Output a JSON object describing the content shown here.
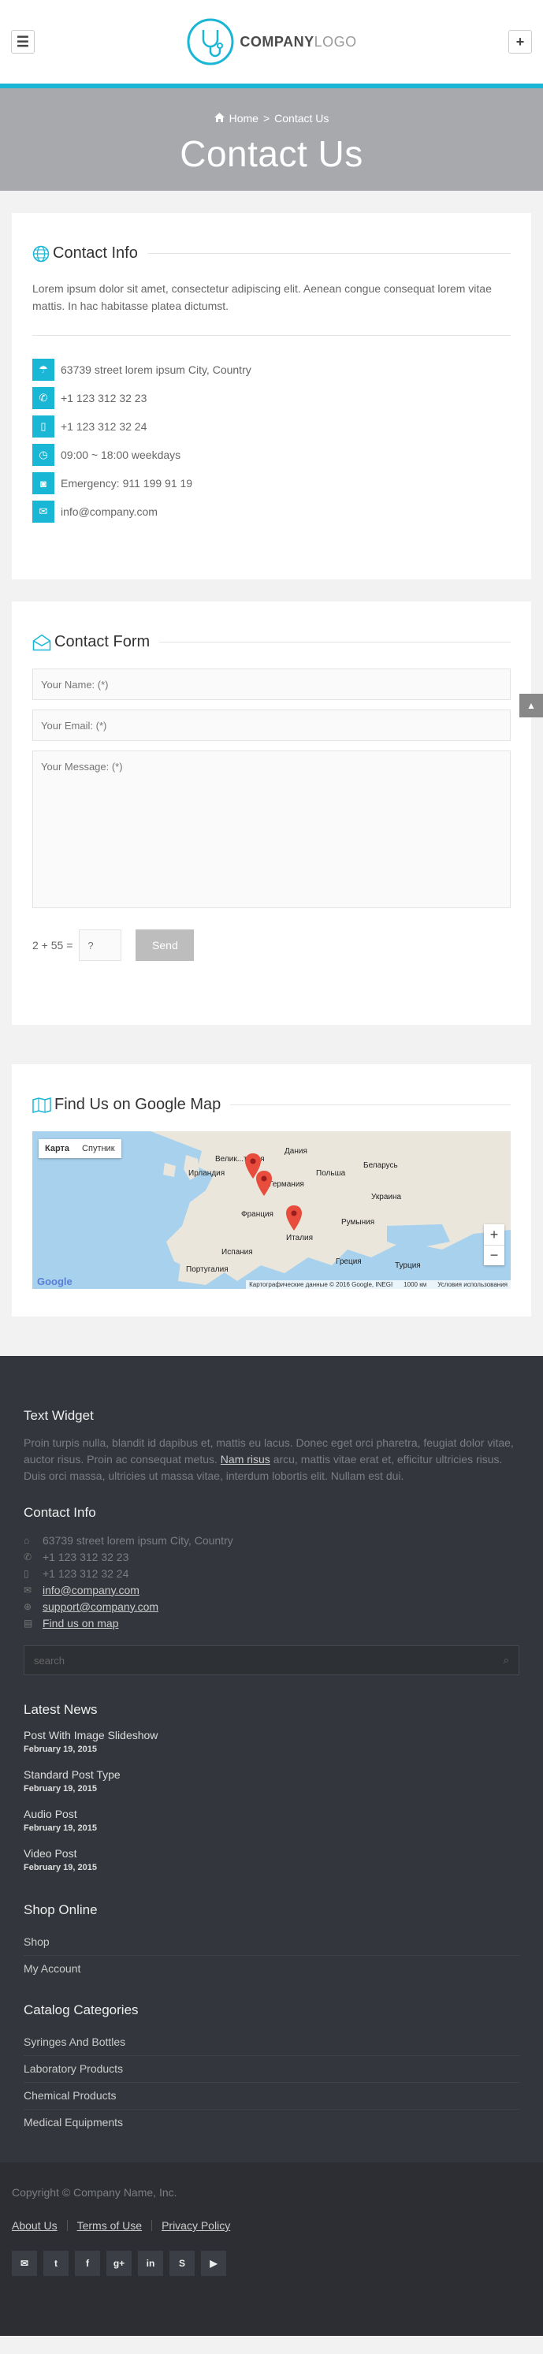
{
  "header": {
    "logo_bold": "COMPANY",
    "logo_light": "LOGO",
    "menu_icon": "hamburger-icon",
    "plus_icon": "plus-icon"
  },
  "banner": {
    "home_label": "Home",
    "separator": ">",
    "current": "Contact Us",
    "title": "Contact Us"
  },
  "contact_info": {
    "title": "Contact Info",
    "description": "Lorem ipsum dolor sit amet, consectetur adipiscing elit. Aenean congue consequat lorem vitae mattis. In hac habitasse platea dictumst.",
    "items": [
      {
        "icon": "map-pin-icon",
        "text": "63739 street lorem ipsum City, Country"
      },
      {
        "icon": "phone-icon",
        "text": "+1 123 312 32 23"
      },
      {
        "icon": "mobile-icon",
        "text": "+1 123 312 32 24"
      },
      {
        "icon": "clock-icon",
        "text": "09:00 ~ 18:00 weekdays"
      },
      {
        "icon": "camera-icon",
        "text": "Emergency: 911 199 91 19"
      },
      {
        "icon": "envelope-icon",
        "text": "info@company.com"
      }
    ]
  },
  "contact_form": {
    "title": "Contact Form",
    "name_placeholder": "Your Name: (*)",
    "email_placeholder": "Your Email: (*)",
    "message_placeholder": "Your Message: (*)",
    "captcha_question": "2 + 55 =",
    "captcha_placeholder": "?",
    "send_label": "Send"
  },
  "map_section": {
    "title": "Find Us on Google Map",
    "tab_map": "Карта",
    "tab_satellite": "Спутник",
    "labels": [
      "Ирландия",
      "Велик...тания",
      "Дания",
      "Германия",
      "Польша",
      "Беларусь",
      "Украина",
      "Франция",
      "Румыния",
      "Италия",
      "Испания",
      "Португалия",
      "Греция",
      "Турция"
    ],
    "attribution": "Картографические данные © 2016 Google, INEGI",
    "scale": "1000 км",
    "terms": "Условия использования",
    "google": "Google"
  },
  "footer": {
    "text_widget_title": "Text Widget",
    "text_before": "Proin turpis nulla, blandit id dapibus et, mattis eu lacus. Donec eget orci pharetra, feugiat dolor vitae, auctor risus. Proin ac consequat metus. ",
    "text_link": "Nam risus",
    "text_after": " arcu, mattis vitae erat et, efficitur ultricies risus. Duis orci massa, ultricies ut massa vitae, interdum lobortis elit. Nullam est dui.",
    "contact_title": "Contact Info",
    "address": "63739 street lorem ipsum City, Country",
    "phone1": "+1 123 312 32 23",
    "phone2": "+1 123 312 32 24",
    "email1": "info@company.com",
    "email2": "support@company.com",
    "map_link": "Find us on map",
    "search_placeholder": "search",
    "news_title": "Latest News",
    "news": [
      {
        "title": "Post With Image Slideshow",
        "date": "February 19, 2015"
      },
      {
        "title": "Standard Post Type",
        "date": "February 19, 2015"
      },
      {
        "title": "Audio Post",
        "date": "February 19, 2015"
      },
      {
        "title": "Video Post",
        "date": "February 19, 2015"
      }
    ],
    "shop_title": "Shop Online",
    "shop_items": [
      "Shop",
      "My Account"
    ],
    "catalog_title": "Catalog Categories",
    "catalog_items": [
      "Syringes And Bottles",
      "Laboratory Products",
      "Chemical Products",
      "Medical Equipments"
    ]
  },
  "bottom": {
    "copyright": "Copyright © Company Name, Inc.",
    "links": [
      "About Us",
      "Terms of Use",
      "Privacy Policy"
    ],
    "socials": [
      {
        "icon": "email-icon",
        "glyph": "✉"
      },
      {
        "icon": "twitter-icon",
        "glyph": "t"
      },
      {
        "icon": "facebook-icon",
        "glyph": "f"
      },
      {
        "icon": "google-plus-icon",
        "glyph": "g+"
      },
      {
        "icon": "linkedin-icon",
        "glyph": "in"
      },
      {
        "icon": "skype-icon",
        "glyph": "S"
      },
      {
        "icon": "youtube-icon",
        "glyph": "▶"
      }
    ]
  },
  "colors": {
    "accent": "#1ab6d6",
    "banner": "#a7a9ad",
    "footer": "#33363c"
  }
}
